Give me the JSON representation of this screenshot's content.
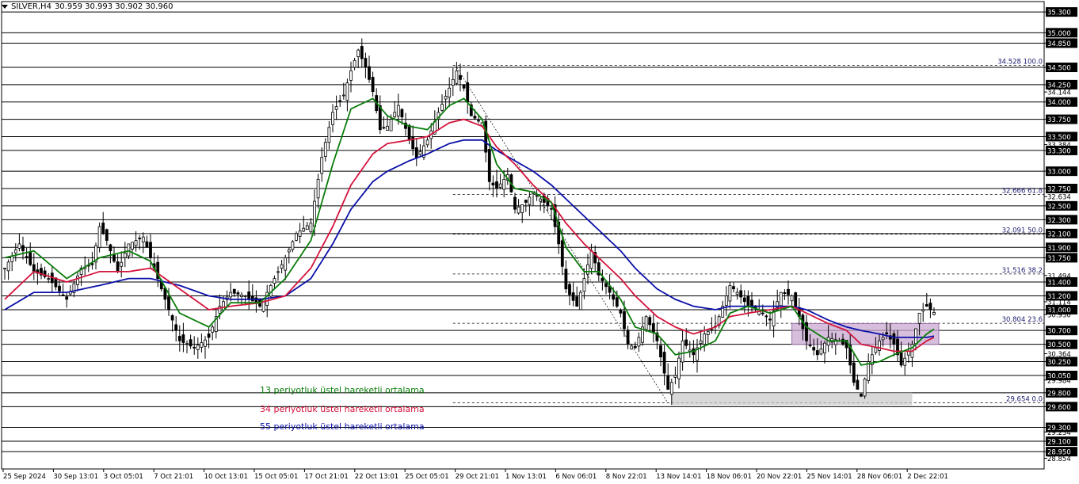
{
  "header": {
    "symbol": "SILVER,H4",
    "ohlc": "30.959 30.993 30.902 30.960"
  },
  "colors": {
    "ema13": "#0a7d0a",
    "ema34": "#d4143c",
    "ema55": "#0a10a8",
    "candle": "#000000",
    "zone": "#c8a8d0",
    "zone_gray": "#c8c8c8"
  },
  "chart_data": {
    "type": "candlestick",
    "symbol": "SILVER",
    "timeframe": "H4",
    "ylim": [
      28.7,
      35.45
    ],
    "x_ticks": [
      "25 Sep 2024",
      "30 Sep 13:01",
      "3 Oct 05:01",
      "7 Oct 21:01",
      "10 Oct 13:01",
      "15 Oct 05:01",
      "17 Oct 21:01",
      "22 Oct 13:01",
      "25 Oct 05:01",
      "29 Oct 21:01",
      "1 Nov 13:01",
      "6 Nov 06:01",
      "8 Nov 22:01",
      "13 Nov 14:01",
      "18 Nov 06:01",
      "20 Nov 22:01",
      "25 Nov 14:01",
      "28 Nov 06:01",
      "2 Dec 22:01"
    ],
    "y_labels": [
      "35.300",
      "35.000",
      "34.850",
      "34.500",
      "34.250",
      "34.144",
      "34.000",
      "33.750",
      "33.500",
      "33.384",
      "33.300",
      "33.000",
      "32.750",
      "32.634",
      "32.500",
      "32.300",
      "32.100",
      "31.900",
      "31.750",
      "31.494",
      "31.400",
      "31.200",
      "31.114",
      "31.000",
      "30.930",
      "30.700",
      "30.500",
      "30.364",
      "30.250",
      "30.050",
      "29.984",
      "29.800",
      "29.600",
      "29.234",
      "29.300",
      "29.100",
      "28.950",
      "28.854"
    ],
    "horizontal_lines": [
      35.3,
      35.0,
      34.85,
      34.5,
      34.25,
      34.0,
      33.75,
      33.5,
      33.3,
      33.0,
      32.75,
      32.5,
      32.3,
      32.1,
      31.9,
      31.75,
      31.4,
      31.2,
      31.0,
      30.7,
      30.5,
      30.25,
      30.05,
      29.8,
      29.6,
      29.3,
      29.1,
      28.95
    ],
    "fibonacci": [
      {
        "price": 34.528,
        "label": "34.528 100.0"
      },
      {
        "price": 32.666,
        "label": "32.666 61.8"
      },
      {
        "price": 32.091,
        "label": "32.091 50.0"
      },
      {
        "price": 31.516,
        "label": "31.516 38.2"
      },
      {
        "price": 30.804,
        "label": "30.804 23.6"
      },
      {
        "price": 29.654,
        "label": "29.654 0.0"
      }
    ],
    "zones": [
      {
        "name": "resistance-zone",
        "from": 30.5,
        "to": 30.8
      },
      {
        "name": "support-zone",
        "from": 29.62,
        "to": 29.8
      }
    ],
    "series": [
      {
        "name": "13 periyotluk üstel hareketli ortalama",
        "key": "ema13"
      },
      {
        "name": "34 periyotluk üstel hareketli ortalama",
        "key": "ema34"
      },
      {
        "name": "55 periyotluk üstel hareketli ortalama",
        "key": "ema55"
      }
    ],
    "price_path": [
      [
        0,
        31.6
      ],
      [
        4,
        31.95
      ],
      [
        8,
        31.55
      ],
      [
        12,
        31.45
      ],
      [
        17,
        31.15
      ],
      [
        21,
        31.6
      ],
      [
        24,
        31.65
      ],
      [
        26,
        32.2
      ],
      [
        28,
        32.0
      ],
      [
        31,
        31.55
      ],
      [
        34,
        31.95
      ],
      [
        38,
        32.05
      ],
      [
        40,
        31.75
      ],
      [
        43,
        31.3
      ],
      [
        48,
        30.55
      ],
      [
        52,
        30.45
      ],
      [
        56,
        30.6
      ],
      [
        59,
        31.05
      ],
      [
        62,
        31.25
      ],
      [
        66,
        31.2
      ],
      [
        70,
        31.05
      ],
      [
        73,
        31.35
      ],
      [
        77,
        31.75
      ],
      [
        80,
        32.1
      ],
      [
        84,
        32.25
      ],
      [
        87,
        33.2
      ],
      [
        90,
        33.85
      ],
      [
        93,
        34.1
      ],
      [
        95,
        34.45
      ],
      [
        97,
        34.75
      ],
      [
        99,
        34.5
      ],
      [
        101,
        34.15
      ],
      [
        103,
        33.6
      ],
      [
        105,
        33.65
      ],
      [
        108,
        33.95
      ],
      [
        111,
        33.45
      ],
      [
        113,
        33.2
      ],
      [
        116,
        33.45
      ],
      [
        119,
        33.85
      ],
      [
        122,
        34.2
      ],
      [
        124,
        34.45
      ],
      [
        126,
        34.2
      ],
      [
        128,
        33.8
      ],
      [
        131,
        33.7
      ],
      [
        133,
        32.85
      ],
      [
        135,
        32.75
      ],
      [
        138,
        32.95
      ],
      [
        140,
        32.45
      ],
      [
        143,
        32.55
      ],
      [
        145,
        32.7
      ],
      [
        148,
        32.55
      ],
      [
        150,
        32.45
      ],
      [
        152,
        31.95
      ],
      [
        154,
        31.3
      ],
      [
        157,
        31.05
      ],
      [
        159,
        31.45
      ],
      [
        161,
        31.85
      ],
      [
        163,
        31.5
      ],
      [
        166,
        31.25
      ],
      [
        169,
        30.95
      ],
      [
        171,
        30.5
      ],
      [
        173,
        30.45
      ],
      [
        176,
        30.9
      ],
      [
        179,
        30.55
      ],
      [
        182,
        29.85
      ],
      [
        184,
        30.05
      ],
      [
        186,
        30.55
      ],
      [
        189,
        30.35
      ],
      [
        192,
        30.65
      ],
      [
        195,
        30.75
      ],
      [
        197,
        31.05
      ],
      [
        199,
        31.35
      ],
      [
        201,
        31.25
      ],
      [
        204,
        31.05
      ],
      [
        207,
        31.0
      ],
      [
        210,
        30.85
      ],
      [
        213,
        31.25
      ],
      [
        216,
        31.2
      ],
      [
        218,
        30.9
      ],
      [
        220,
        30.55
      ],
      [
        223,
        30.35
      ],
      [
        226,
        30.6
      ],
      [
        229,
        30.55
      ],
      [
        231,
        30.45
      ],
      [
        233,
        29.95
      ],
      [
        235,
        29.75
      ],
      [
        237,
        30.25
      ],
      [
        240,
        30.55
      ],
      [
        242,
        30.65
      ],
      [
        244,
        30.5
      ],
      [
        246,
        30.2
      ],
      [
        249,
        30.5
      ],
      [
        251,
        30.95
      ],
      [
        253,
        31.05
      ],
      [
        255,
        30.96
      ]
    ],
    "ema13": [
      [
        0,
        31.75
      ],
      [
        8,
        31.85
      ],
      [
        17,
        31.45
      ],
      [
        26,
        31.75
      ],
      [
        34,
        31.85
      ],
      [
        40,
        31.7
      ],
      [
        48,
        30.95
      ],
      [
        56,
        30.75
      ],
      [
        62,
        31.1
      ],
      [
        70,
        31.1
      ],
      [
        77,
        31.45
      ],
      [
        84,
        32.0
      ],
      [
        90,
        33.1
      ],
      [
        95,
        33.9
      ],
      [
        101,
        34.05
      ],
      [
        105,
        33.8
      ],
      [
        111,
        33.65
      ],
      [
        116,
        33.6
      ],
      [
        122,
        33.95
      ],
      [
        126,
        34.05
      ],
      [
        131,
        33.75
      ],
      [
        135,
        33.1
      ],
      [
        140,
        32.75
      ],
      [
        145,
        32.7
      ],
      [
        150,
        32.55
      ],
      [
        154,
        31.9
      ],
      [
        159,
        31.55
      ],
      [
        163,
        31.55
      ],
      [
        169,
        31.15
      ],
      [
        173,
        30.75
      ],
      [
        179,
        30.65
      ],
      [
        184,
        30.35
      ],
      [
        189,
        30.4
      ],
      [
        195,
        30.55
      ],
      [
        199,
        30.95
      ],
      [
        204,
        31.05
      ],
      [
        210,
        30.95
      ],
      [
        216,
        31.05
      ],
      [
        220,
        30.75
      ],
      [
        226,
        30.55
      ],
      [
        231,
        30.55
      ],
      [
        235,
        30.2
      ],
      [
        240,
        30.25
      ],
      [
        244,
        30.35
      ],
      [
        249,
        30.45
      ],
      [
        253,
        30.65
      ],
      [
        255,
        30.72
      ]
    ],
    "ema34": [
      [
        0,
        31.15
      ],
      [
        8,
        31.55
      ],
      [
        17,
        31.4
      ],
      [
        26,
        31.55
      ],
      [
        34,
        31.55
      ],
      [
        40,
        31.6
      ],
      [
        48,
        31.3
      ],
      [
        56,
        31.0
      ],
      [
        62,
        31.05
      ],
      [
        70,
        31.1
      ],
      [
        77,
        31.2
      ],
      [
        84,
        31.6
      ],
      [
        90,
        32.2
      ],
      [
        95,
        32.8
      ],
      [
        101,
        33.25
      ],
      [
        105,
        33.4
      ],
      [
        111,
        33.45
      ],
      [
        116,
        33.5
      ],
      [
        122,
        33.7
      ],
      [
        126,
        33.75
      ],
      [
        131,
        33.65
      ],
      [
        135,
        33.35
      ],
      [
        140,
        33.1
      ],
      [
        145,
        32.8
      ],
      [
        150,
        32.55
      ],
      [
        154,
        32.25
      ],
      [
        159,
        31.95
      ],
      [
        163,
        31.75
      ],
      [
        169,
        31.45
      ],
      [
        173,
        31.2
      ],
      [
        179,
        30.9
      ],
      [
        184,
        30.75
      ],
      [
        189,
        30.65
      ],
      [
        195,
        30.75
      ],
      [
        199,
        30.9
      ],
      [
        204,
        30.95
      ],
      [
        210,
        31.0
      ],
      [
        216,
        31.05
      ],
      [
        220,
        30.95
      ],
      [
        226,
        30.8
      ],
      [
        231,
        30.7
      ],
      [
        235,
        30.5
      ],
      [
        240,
        30.45
      ],
      [
        244,
        30.4
      ],
      [
        249,
        30.4
      ],
      [
        253,
        30.55
      ],
      [
        255,
        30.6
      ]
    ],
    "ema55": [
      [
        0,
        31.0
      ],
      [
        8,
        31.25
      ],
      [
        17,
        31.25
      ],
      [
        26,
        31.35
      ],
      [
        34,
        31.45
      ],
      [
        40,
        31.45
      ],
      [
        48,
        31.35
      ],
      [
        56,
        31.2
      ],
      [
        62,
        31.15
      ],
      [
        70,
        31.15
      ],
      [
        77,
        31.2
      ],
      [
        84,
        31.45
      ],
      [
        90,
        31.95
      ],
      [
        95,
        32.45
      ],
      [
        101,
        32.85
      ],
      [
        105,
        33.0
      ],
      [
        111,
        33.15
      ],
      [
        116,
        33.25
      ],
      [
        122,
        33.4
      ],
      [
        126,
        33.45
      ],
      [
        131,
        33.45
      ],
      [
        135,
        33.3
      ],
      [
        140,
        33.15
      ],
      [
        145,
        33.0
      ],
      [
        150,
        32.8
      ],
      [
        154,
        32.6
      ],
      [
        159,
        32.35
      ],
      [
        163,
        32.15
      ],
      [
        169,
        31.85
      ],
      [
        173,
        31.6
      ],
      [
        179,
        31.3
      ],
      [
        184,
        31.15
      ],
      [
        189,
        31.05
      ],
      [
        195,
        31.0
      ],
      [
        199,
        31.05
      ],
      [
        204,
        31.05
      ],
      [
        210,
        31.05
      ],
      [
        216,
        31.05
      ],
      [
        220,
        31.0
      ],
      [
        226,
        30.85
      ],
      [
        231,
        30.75
      ],
      [
        235,
        30.7
      ],
      [
        240,
        30.65
      ],
      [
        244,
        30.6
      ],
      [
        249,
        30.6
      ],
      [
        253,
        30.6
      ],
      [
        255,
        30.62
      ]
    ]
  },
  "legend": {
    "ema13": "13 periyotluk üstel hareketli ortalama",
    "ema34": "34 periyotluk üstel hareketli ortalama",
    "ema55": "55 periyotluk üstel hareketli ortalama"
  }
}
